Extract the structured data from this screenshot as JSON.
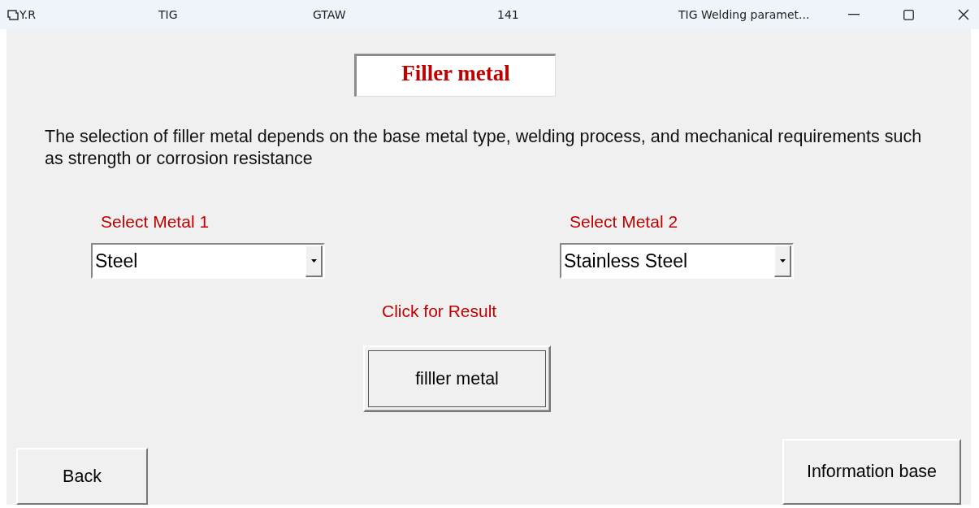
{
  "window": {
    "title_items": [
      "Y.R",
      "TIG",
      "GTAW",
      "141",
      "TIG Welding paramet..."
    ]
  },
  "heading": "Filler metal",
  "description": "The selection of filler metal depends on the base metal type, welding process, and mechanical requirements such as strength or corrosion resistance",
  "selects": [
    {
      "label": "Select Metal 1",
      "value": "Steel"
    },
    {
      "label": "Select Metal 2",
      "value": "Stainless Steel"
    }
  ],
  "result_label": "Click for Result",
  "result_button": "filller metal",
  "back_button": "Back",
  "info_button": "Information base"
}
